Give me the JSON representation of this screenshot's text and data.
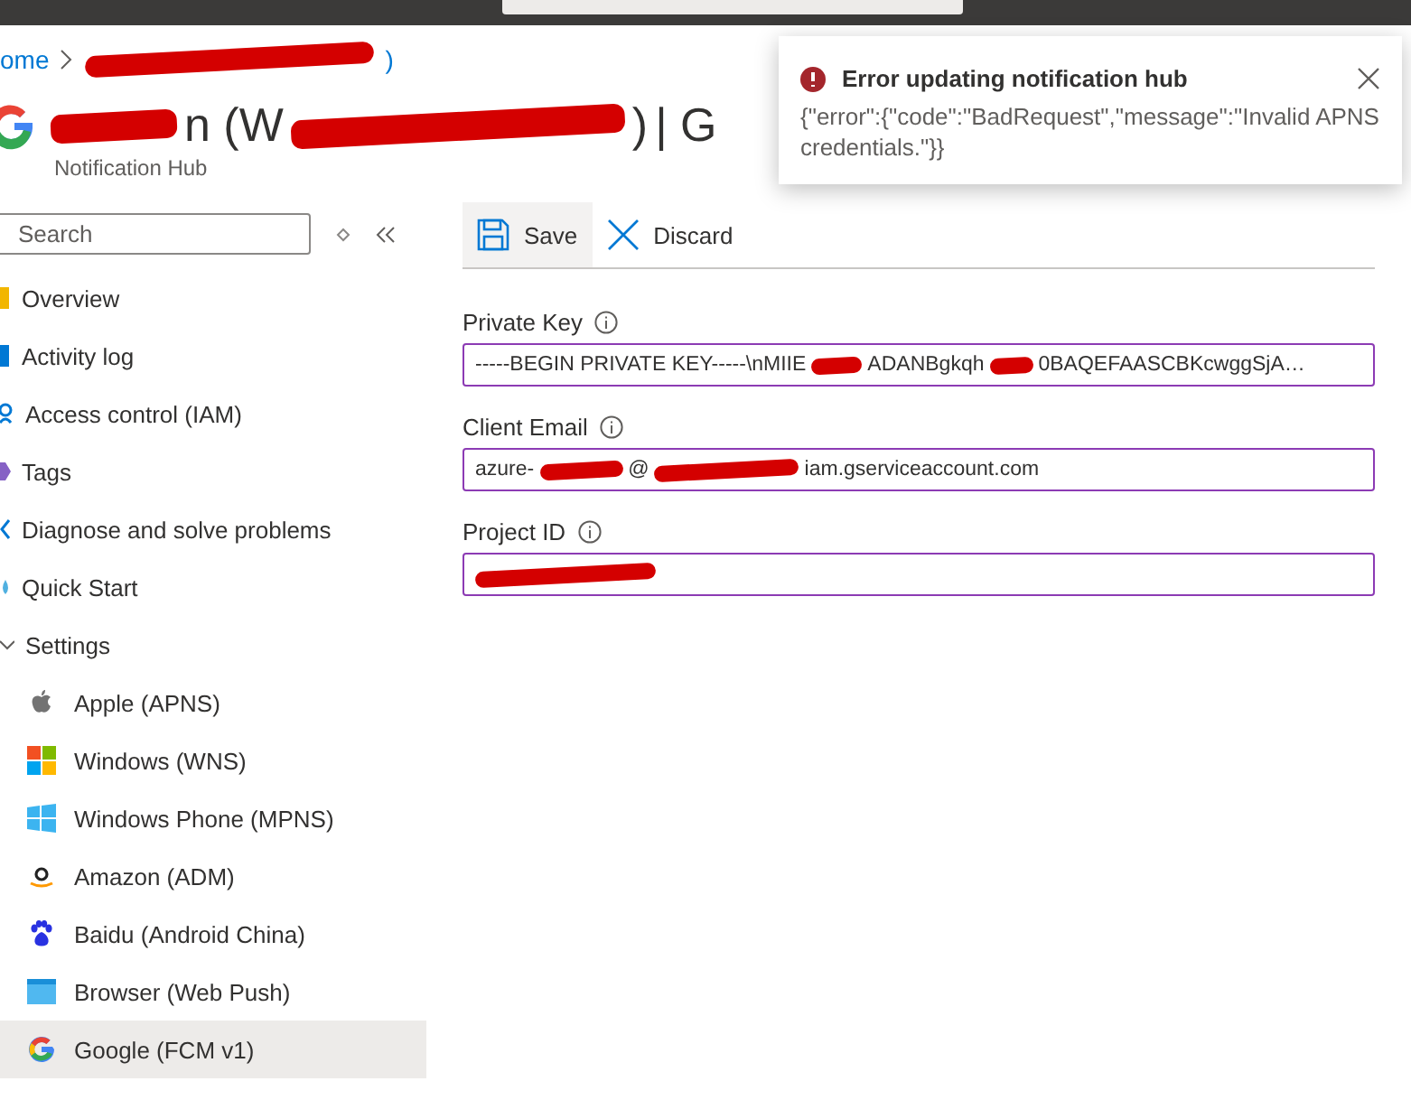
{
  "breadcrumb": [
    {
      "kind": "text",
      "text": "ome"
    },
    {
      "kind": "chevron"
    },
    {
      "kind": "redaction"
    },
    {
      "kind": "text",
      "text": ")"
    }
  ],
  "title": {
    "segments": [
      {
        "kind": "redaction"
      },
      {
        "kind": "text",
        "text": "n (W"
      },
      {
        "kind": "redaction"
      },
      {
        "kind": "text",
        "text": ")"
      },
      {
        "kind": "text",
        "text": "| G"
      }
    ],
    "subtitle": "Notification Hub"
  },
  "sidebar": {
    "search": {
      "placeholder": "Search"
    },
    "items": [
      {
        "kind": "overview",
        "label": "Overview",
        "selected": false
      },
      {
        "kind": "activity",
        "label": "Activity log",
        "selected": false
      },
      {
        "kind": "access",
        "label": "Access control (IAM)",
        "selected": false
      },
      {
        "kind": "tags",
        "label": "Tags",
        "selected": false
      },
      {
        "kind": "diagnose",
        "label": "Diagnose and solve problems",
        "selected": false
      },
      {
        "kind": "quickstart",
        "label": "Quick Start",
        "selected": false
      },
      {
        "kind": "group",
        "label": "Settings",
        "expanded": true,
        "children": [
          {
            "kind": "apple",
            "label": "Apple (APNS)",
            "selected": false
          },
          {
            "kind": "windows",
            "label": "Windows (WNS)",
            "selected": false
          },
          {
            "kind": "winphone",
            "label": "Windows Phone (MPNS)",
            "selected": false
          },
          {
            "kind": "amazon",
            "label": "Amazon (ADM)",
            "selected": false
          },
          {
            "kind": "baidu",
            "label": "Baidu (Android China)",
            "selected": false
          },
          {
            "kind": "browser",
            "label": "Browser (Web Push)",
            "selected": false
          },
          {
            "kind": "google",
            "label": "Google (FCM v1)",
            "selected": true
          }
        ]
      }
    ]
  },
  "toolbar": [
    {
      "kind": "save",
      "label": "Save",
      "highlighted": true
    },
    {
      "kind": "discard",
      "label": "Discard",
      "highlighted": false
    }
  ],
  "fields": [
    {
      "label": "Private Key",
      "segments": [
        {
          "kind": "text",
          "text": "-----BEGIN PRIVATE KEY-----\\nMIIE"
        },
        {
          "kind": "redaction"
        },
        {
          "kind": "text",
          "text": "ADANBgkqh"
        },
        {
          "kind": "redaction"
        },
        {
          "kind": "text",
          "text": "0BAQEFAASCBKcwggSjA…"
        }
      ]
    },
    {
      "label": "Client Email",
      "segments": [
        {
          "kind": "text",
          "text": "azure-"
        },
        {
          "kind": "redaction"
        },
        {
          "kind": "text",
          "text": "@"
        },
        {
          "kind": "redaction"
        },
        {
          "kind": "text",
          "text": "iam.gserviceaccount.com"
        }
      ]
    },
    {
      "label": "Project ID",
      "segments": [
        {
          "kind": "redaction"
        }
      ]
    }
  ],
  "toast": {
    "title": "Error updating notification hub",
    "message": "{\"error\":{\"code\":\"BadRequest\",\"message\":\"Invalid APNS credentials.\"}}"
  }
}
